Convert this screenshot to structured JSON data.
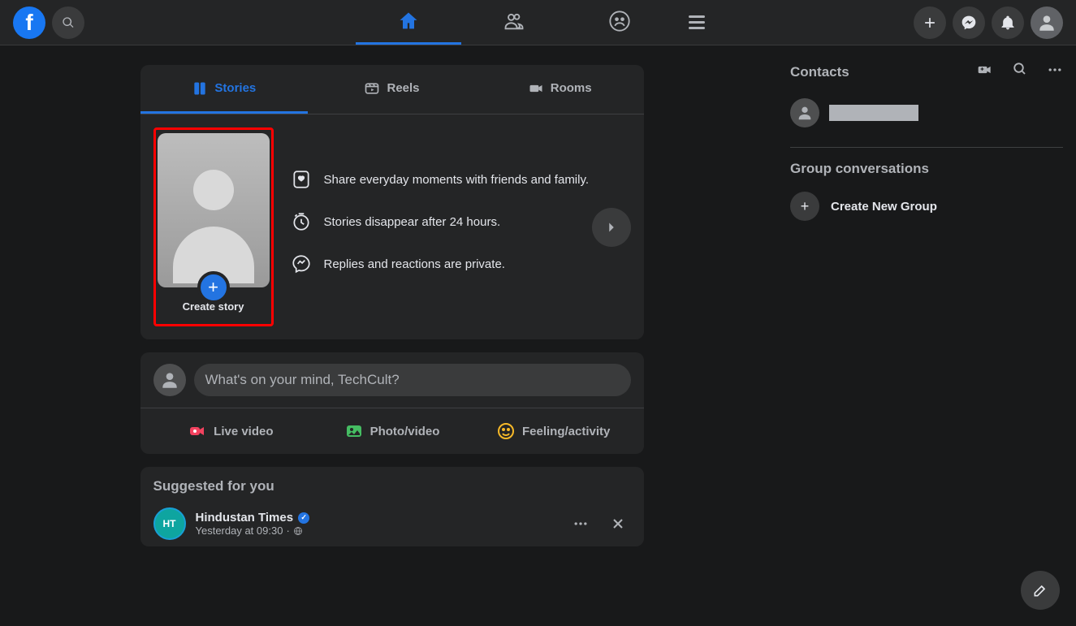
{
  "nav": {
    "home": "home",
    "friends": "friends",
    "groups": "groups",
    "menu": "menu"
  },
  "stories": {
    "tabs": {
      "stories": "Stories",
      "reels": "Reels",
      "rooms": "Rooms"
    },
    "create_label": "Create story",
    "info1": "Share everyday moments with friends and family.",
    "info2": "Stories disappear after 24 hours.",
    "info3": "Replies and reactions are private."
  },
  "composer": {
    "placeholder": "What's on your mind, TechCult?",
    "live": "Live video",
    "photo": "Photo/video",
    "feeling": "Feeling/activity"
  },
  "suggested": {
    "header": "Suggested for you",
    "item": {
      "name": "Hindustan Times",
      "meta": "Yesterday at 09:30",
      "avatar_text": "HT"
    }
  },
  "right": {
    "contacts_title": "Contacts",
    "group_title": "Group conversations",
    "create_group": "Create New Group"
  }
}
